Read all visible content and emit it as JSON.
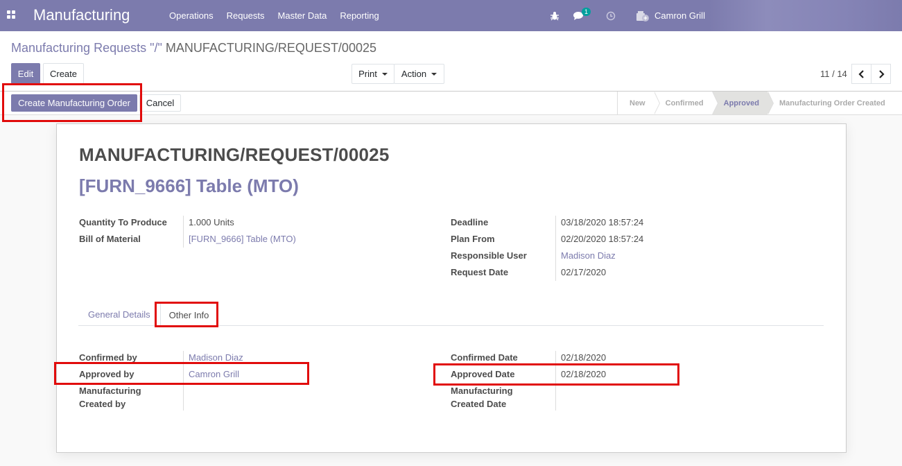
{
  "navbar": {
    "app_title": "Manufacturing",
    "menu": [
      "Operations",
      "Requests",
      "Master Data",
      "Reporting"
    ],
    "chat_badge": "1",
    "user_name": "Camron Grill"
  },
  "breadcrumb": {
    "parent": "Manufacturing Requests",
    "separator": "\"/\"",
    "current": "MANUFACTURING/REQUEST/00025"
  },
  "buttons": {
    "edit": "Edit",
    "create": "Create",
    "print": "Print",
    "action": "Action",
    "create_mo": "Create Manufacturing Order",
    "cancel": "Cancel"
  },
  "pager": {
    "text": "11 / 14"
  },
  "stages": [
    {
      "label": "New",
      "active": false
    },
    {
      "label": "Confirmed",
      "active": false
    },
    {
      "label": "Approved",
      "active": true
    },
    {
      "label": "Manufacturing Order Created",
      "active": false
    }
  ],
  "form": {
    "name": "MANUFACTURING/REQUEST/00025",
    "product": "[FURN_9666] Table (MTO)",
    "left": {
      "qty_label": "Quantity To Produce",
      "qty_value": "1.000 Units",
      "bom_label": "Bill of Material",
      "bom_value": "[FURN_9666] Table (MTO)"
    },
    "right": {
      "deadline_label": "Deadline",
      "deadline_value": "03/18/2020 18:57:24",
      "plan_label": "Plan From",
      "plan_value": "02/20/2020 18:57:24",
      "user_label": "Responsible User",
      "user_value": "Madison Diaz",
      "request_label": "Request Date",
      "request_value": "02/17/2020"
    }
  },
  "tabs": {
    "general": "General Details",
    "other": "Other Info"
  },
  "other_info": {
    "confirmed_by_label": "Confirmed by",
    "confirmed_by_value": "Madison Diaz",
    "approved_by_label": "Approved by",
    "approved_by_value": "Camron Grill",
    "mfg_created_by_label_1": "Manufacturing",
    "mfg_created_by_label_2": "Created by",
    "confirmed_date_label": "Confirmed Date",
    "confirmed_date_value": "02/18/2020",
    "approved_date_label": "Approved Date",
    "approved_date_value": "02/18/2020",
    "mfg_created_date_label_1": "Manufacturing",
    "mfg_created_date_label_2": "Created Date"
  },
  "colors": {
    "brand": "#7c7bad",
    "highlight": "#e10b0b"
  }
}
